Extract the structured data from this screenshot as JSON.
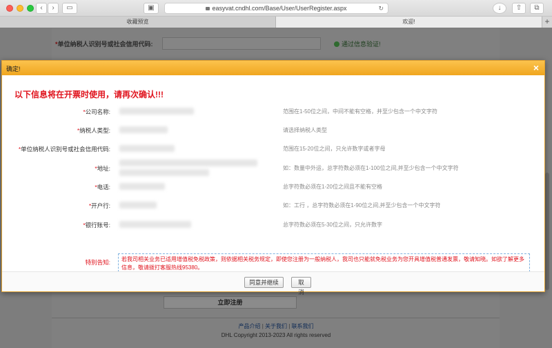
{
  "browser": {
    "url": "easyvat.cndhl.com/Base/User/UserRegister.aspx",
    "tabs": [
      {
        "label": "收藏预览",
        "active": false
      },
      {
        "label": "欢迎!",
        "active": true
      }
    ]
  },
  "background_page": {
    "field_label": "单位纳税人识别号或社会信用代码:",
    "field_status": "通过信息验证!",
    "register_button": "立即注册",
    "footer_links": [
      "产品介绍",
      "关于我们",
      "联系我们"
    ],
    "footer_separator": "|",
    "copyright": "DHL Copyright 2013-2023 All rights reserved"
  },
  "modal": {
    "title": "确定!",
    "close_glyph": "×",
    "warning": "以下信息将在开票时使用，请再次确认!!!",
    "required_mark": "*",
    "fields": [
      {
        "label": "公司名称:",
        "hint": "范围在1-50位之间，中间不能有空格，并至少包含一个中文字符"
      },
      {
        "label": "纳税人类型:",
        "hint": "请选择纳税人类型"
      },
      {
        "label": "单位纳税人识别号或社会信用代码:",
        "hint": "范围在15-20位之间，只允许数字或者字母"
      },
      {
        "label": "地址:",
        "hint": "如：数量中外运，总字符数必须在1-100位之间,并至少包含一个中文字符"
      },
      {
        "label": "电话:",
        "hint": "总字符数必须在1-20位之间且不能有空格"
      },
      {
        "label": "开户行:",
        "hint": "如：工行 ，总字符数必须在1-90位之间,并至少包含一个中文字符"
      },
      {
        "label": "银行账号:",
        "hint": "总字符数必须在5-30位之间，只允许数字"
      }
    ],
    "notice_label": "特别告知:",
    "notice_text": "若我司相关业务已适用增值税免税政策，则依据相关税务规定，即使您注册为一般纳税人，我司也只能就免税业务为您开具增值税普通发票，敬请知晓。如欲了解更多信息，敬请拨打客服热线95380。",
    "buttons": {
      "agree": "同意并继续",
      "cancel": "取消"
    }
  },
  "colors": {
    "warning_red": "#e0141e",
    "header_orange": "#f0a61f",
    "hint_gray": "#8a8a8a"
  }
}
